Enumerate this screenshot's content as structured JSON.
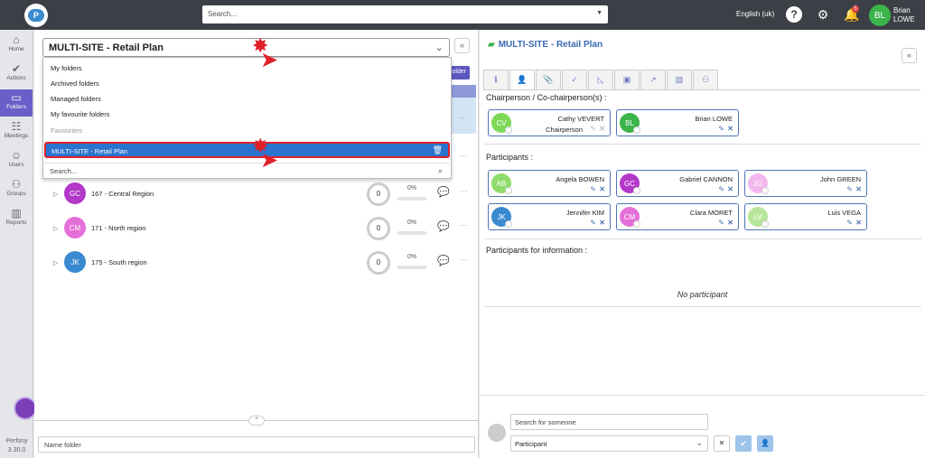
{
  "topbar": {
    "logo_letter": "P",
    "search_placeholder": "Search...",
    "language": "English (uk)",
    "notification_count": "5",
    "user_initials": "BL",
    "user_first": "Brian",
    "user_last": "LOWE",
    "colors": {
      "bar": "#3c3f45",
      "avatar": "#3bb44a"
    }
  },
  "sidebar": {
    "items": [
      {
        "label": "Home",
        "icon": "home-icon"
      },
      {
        "label": "Actions",
        "icon": "check-circle-icon"
      },
      {
        "label": "Folders",
        "icon": "folder-icon"
      },
      {
        "label": "Meetings",
        "icon": "meetings-icon"
      },
      {
        "label": "Users",
        "icon": "users-icon"
      },
      {
        "label": "Groups",
        "icon": "groups-icon"
      },
      {
        "label": "Reports",
        "icon": "reports-icon"
      }
    ],
    "brand": "Perfony",
    "version": "3.30.0",
    "active_color": "#6a5fc8"
  },
  "left": {
    "folder_select": "MULTI-SITE - Retail Plan",
    "new_folder_label": "older",
    "dropdown": {
      "items": [
        "My folders",
        "Archived folders",
        "Managed folders",
        "My favourite folders"
      ],
      "favourites_header": "Favourites",
      "selected": "MULTI-SITE - Retail Plan",
      "search_placeholder": "Search..."
    },
    "rows": [
      {
        "initials": "GC",
        "name": "167 - Central Region",
        "ring": "0",
        "pct": "0%",
        "progress": 0,
        "color": "#b338c9"
      },
      {
        "initials": "CM",
        "name": "171 - North region",
        "ring": "0",
        "pct": "0%",
        "progress": 0,
        "color": "#e56fd8"
      },
      {
        "initials": "JK",
        "name": "175 - South region",
        "ring": "0",
        "pct": "0%",
        "progress": 0,
        "color": "#3a8ad0"
      }
    ],
    "name_folder_placeholder": "Name folder"
  },
  "right": {
    "title": "MULTI-SITE - Retail Plan",
    "tabs": [
      "info-icon",
      "participants-icon",
      "attachment-icon",
      "check-icon",
      "chart-icon",
      "calendar-icon",
      "trend-icon",
      "image-icon",
      "groups-icon"
    ],
    "chair_section": "Chairperson / Co-chairperson(s) :",
    "chairs": [
      {
        "initials": "CV",
        "name": "Cathy VEVERT",
        "role": "Chairperson",
        "color": "#7ed957"
      },
      {
        "initials": "BL",
        "name": "Brian LOWE",
        "role": "",
        "color": "#3bb44a"
      }
    ],
    "participants_section": "Participants :",
    "participants": [
      {
        "initials": "AB",
        "name": "Angela BOWEN",
        "color": "#8fdc6a"
      },
      {
        "initials": "GC",
        "name": "Gabriel CANNON",
        "color": "#b338c9"
      },
      {
        "initials": "JG",
        "name": "John GREEN",
        "color": "#f2b8ee"
      },
      {
        "initials": "JK",
        "name": "Jennifer KIM",
        "color": "#3a8ad0"
      },
      {
        "initials": "CM",
        "name": "Clara MORET",
        "color": "#e56fd8"
      },
      {
        "initials": "LV",
        "name": "Luis VEGA",
        "color": "#b7e69a"
      }
    ],
    "info_section": "Participants for information :",
    "no_participant": "No participant",
    "search_someone_placeholder": "Search for someone",
    "role_selected": "Participant"
  }
}
